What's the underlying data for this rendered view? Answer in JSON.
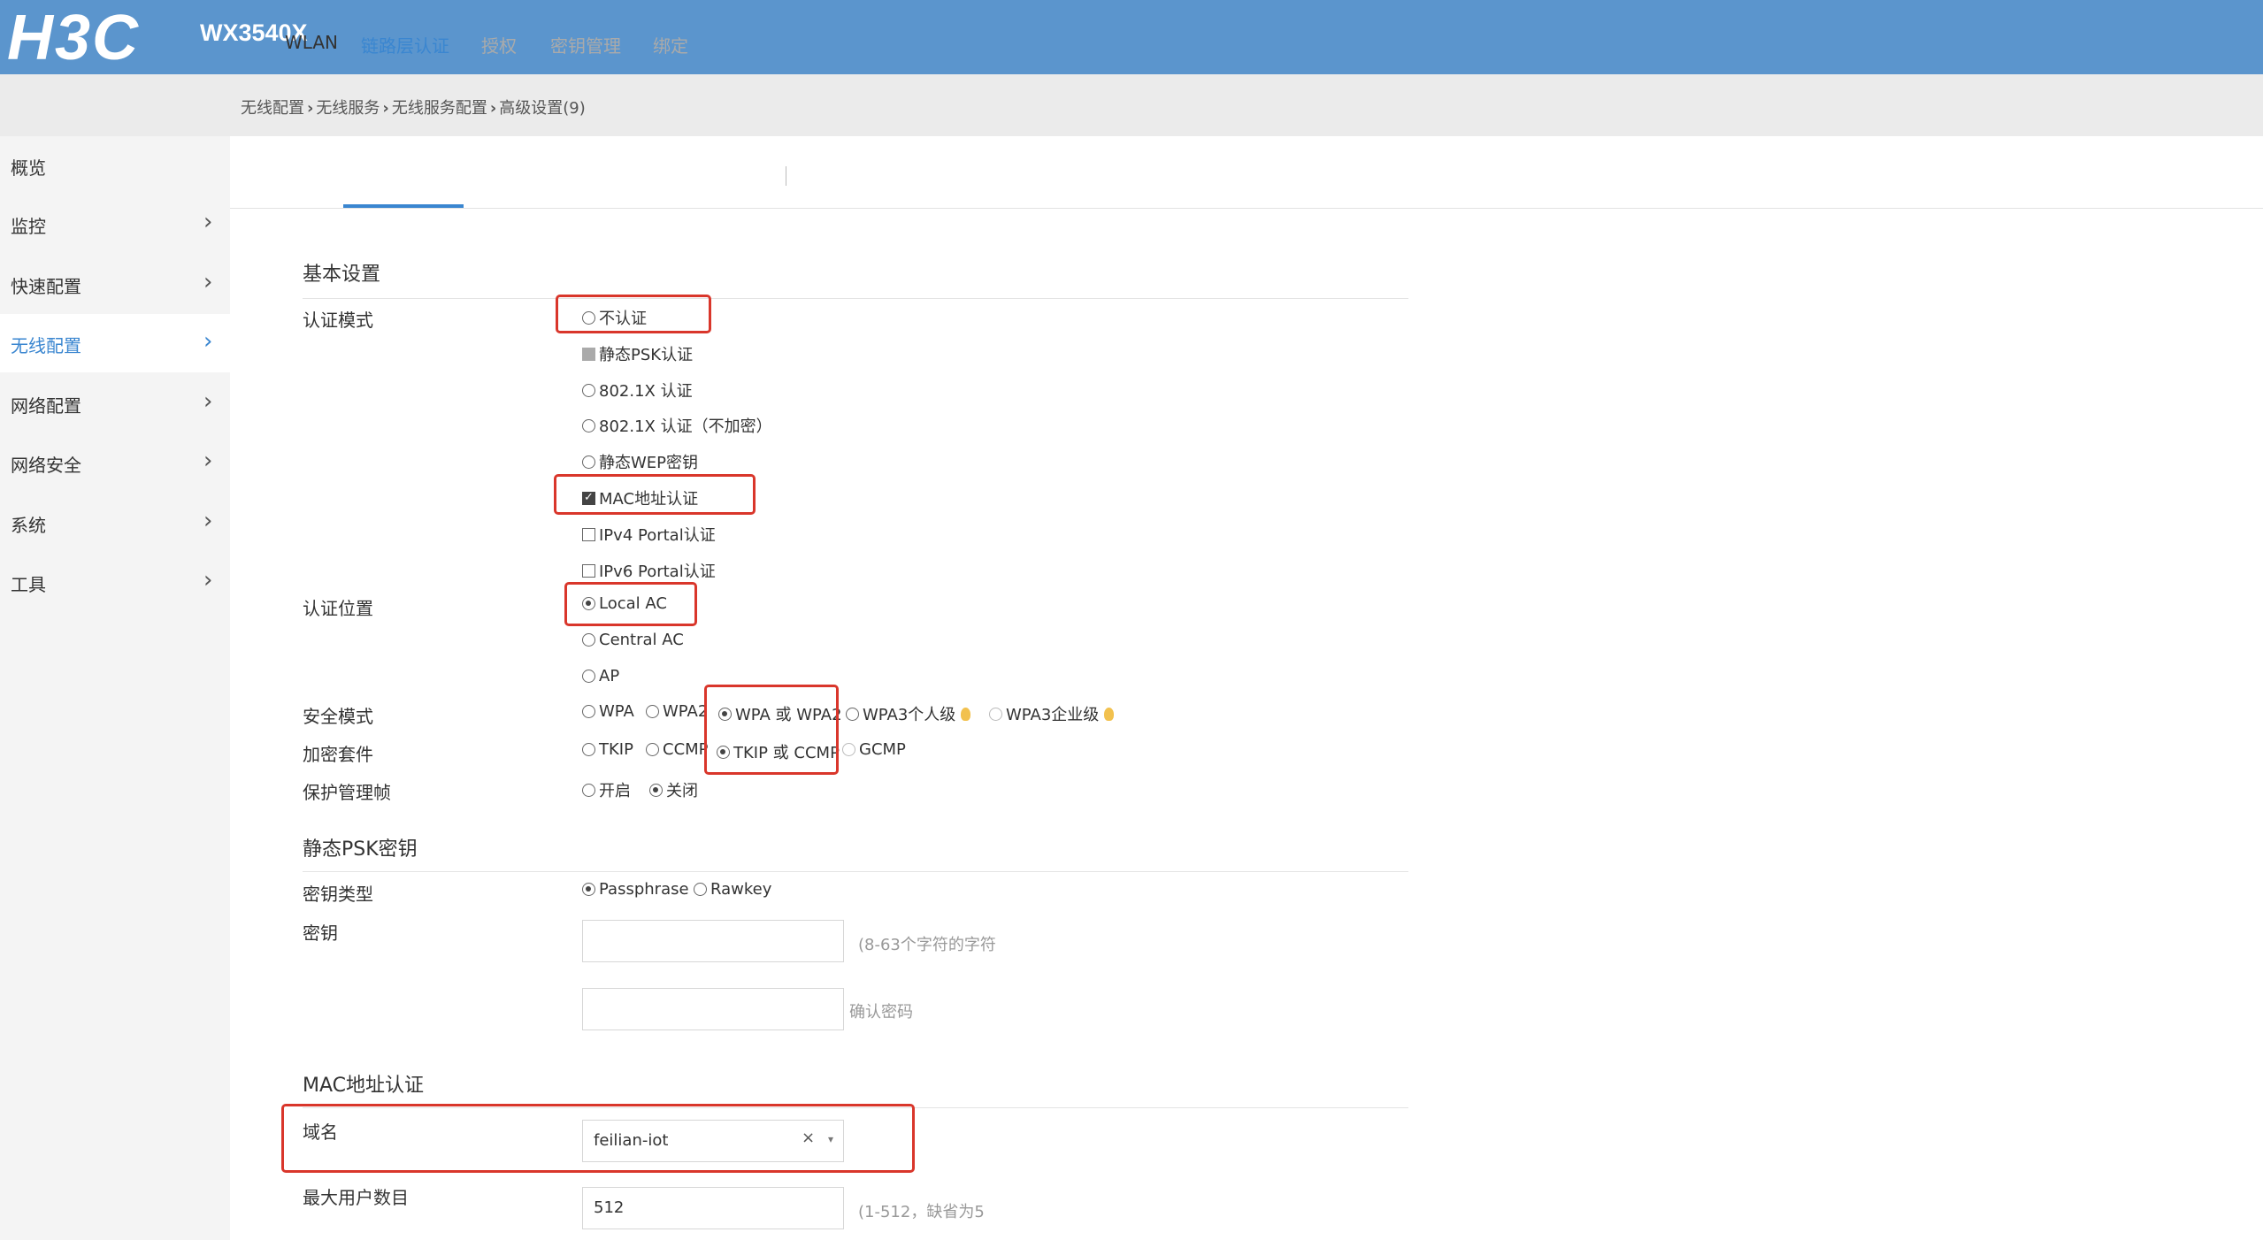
{
  "header": {
    "logo": "H3C",
    "model": "WX3540X"
  },
  "breadcrumb": [
    "无线配置",
    "无线服务",
    "无线服务配置",
    "高级设置(9)"
  ],
  "sidebar": {
    "items": [
      {
        "label": "概览",
        "arrow": ""
      },
      {
        "label": "监控",
        "arrow": "›"
      },
      {
        "label": "快速配置",
        "arrow": "›"
      },
      {
        "label": "无线配置",
        "arrow": "›"
      },
      {
        "label": "网络配置",
        "arrow": "›"
      },
      {
        "label": "网络安全",
        "arrow": "›"
      },
      {
        "label": "系统",
        "arrow": "›"
      },
      {
        "label": "工具",
        "arrow": "›"
      }
    ],
    "active": "无线配置"
  },
  "tabs": [
    "WLAN",
    "链路层认证",
    "授权",
    "密钥管理",
    "绑定"
  ],
  "active_tab": "链路层认证",
  "basic": {
    "title": "基本设置",
    "auth_mode_label": "认证模式",
    "auth_modes": [
      "不认证",
      "静态PSK认证",
      "802.1X 认证",
      "802.1X 认证（不加密）",
      "静态WEP密钥"
    ],
    "auth_checks": [
      "MAC地址认证",
      "IPv4 Portal认证",
      "IPv6 Portal认证"
    ],
    "auth_pos_label": "认证位置",
    "auth_positions": [
      "Local AC",
      "Central AC",
      "AP"
    ],
    "security_label": "安全模式",
    "security_modes": [
      "WPA",
      "WPA2",
      "WPA 或 WPA2",
      "WPA3个人级",
      "WPA3企业级"
    ],
    "cipher_label": "加密套件",
    "ciphers": [
      "TKIP",
      "CCMP",
      "TKIP 或 CCMP",
      "GCMP"
    ],
    "pmf_label": "保护管理帧",
    "pmf_options": [
      "开启",
      "关闭"
    ]
  },
  "psk": {
    "title": "静态PSK密钥",
    "key_type_label": "密钥类型",
    "key_types": [
      "Passphrase",
      "Rawkey"
    ],
    "key_label": "密钥",
    "key_hint": "(8-63个字符的字符",
    "confirm_hint": "确认密码"
  },
  "mac": {
    "title": "MAC地址认证",
    "domain_label": "域名",
    "domain_value": "feilian-iot",
    "clear": "×",
    "caret": "▾",
    "max_users_label": "最大用户数目",
    "max_users_value": "512",
    "max_users_hint": "(1-512，缺省为5"
  },
  "colors": {
    "header": "#5b95cd",
    "accent": "#3a86d0",
    "highlight": "#d9362b"
  }
}
